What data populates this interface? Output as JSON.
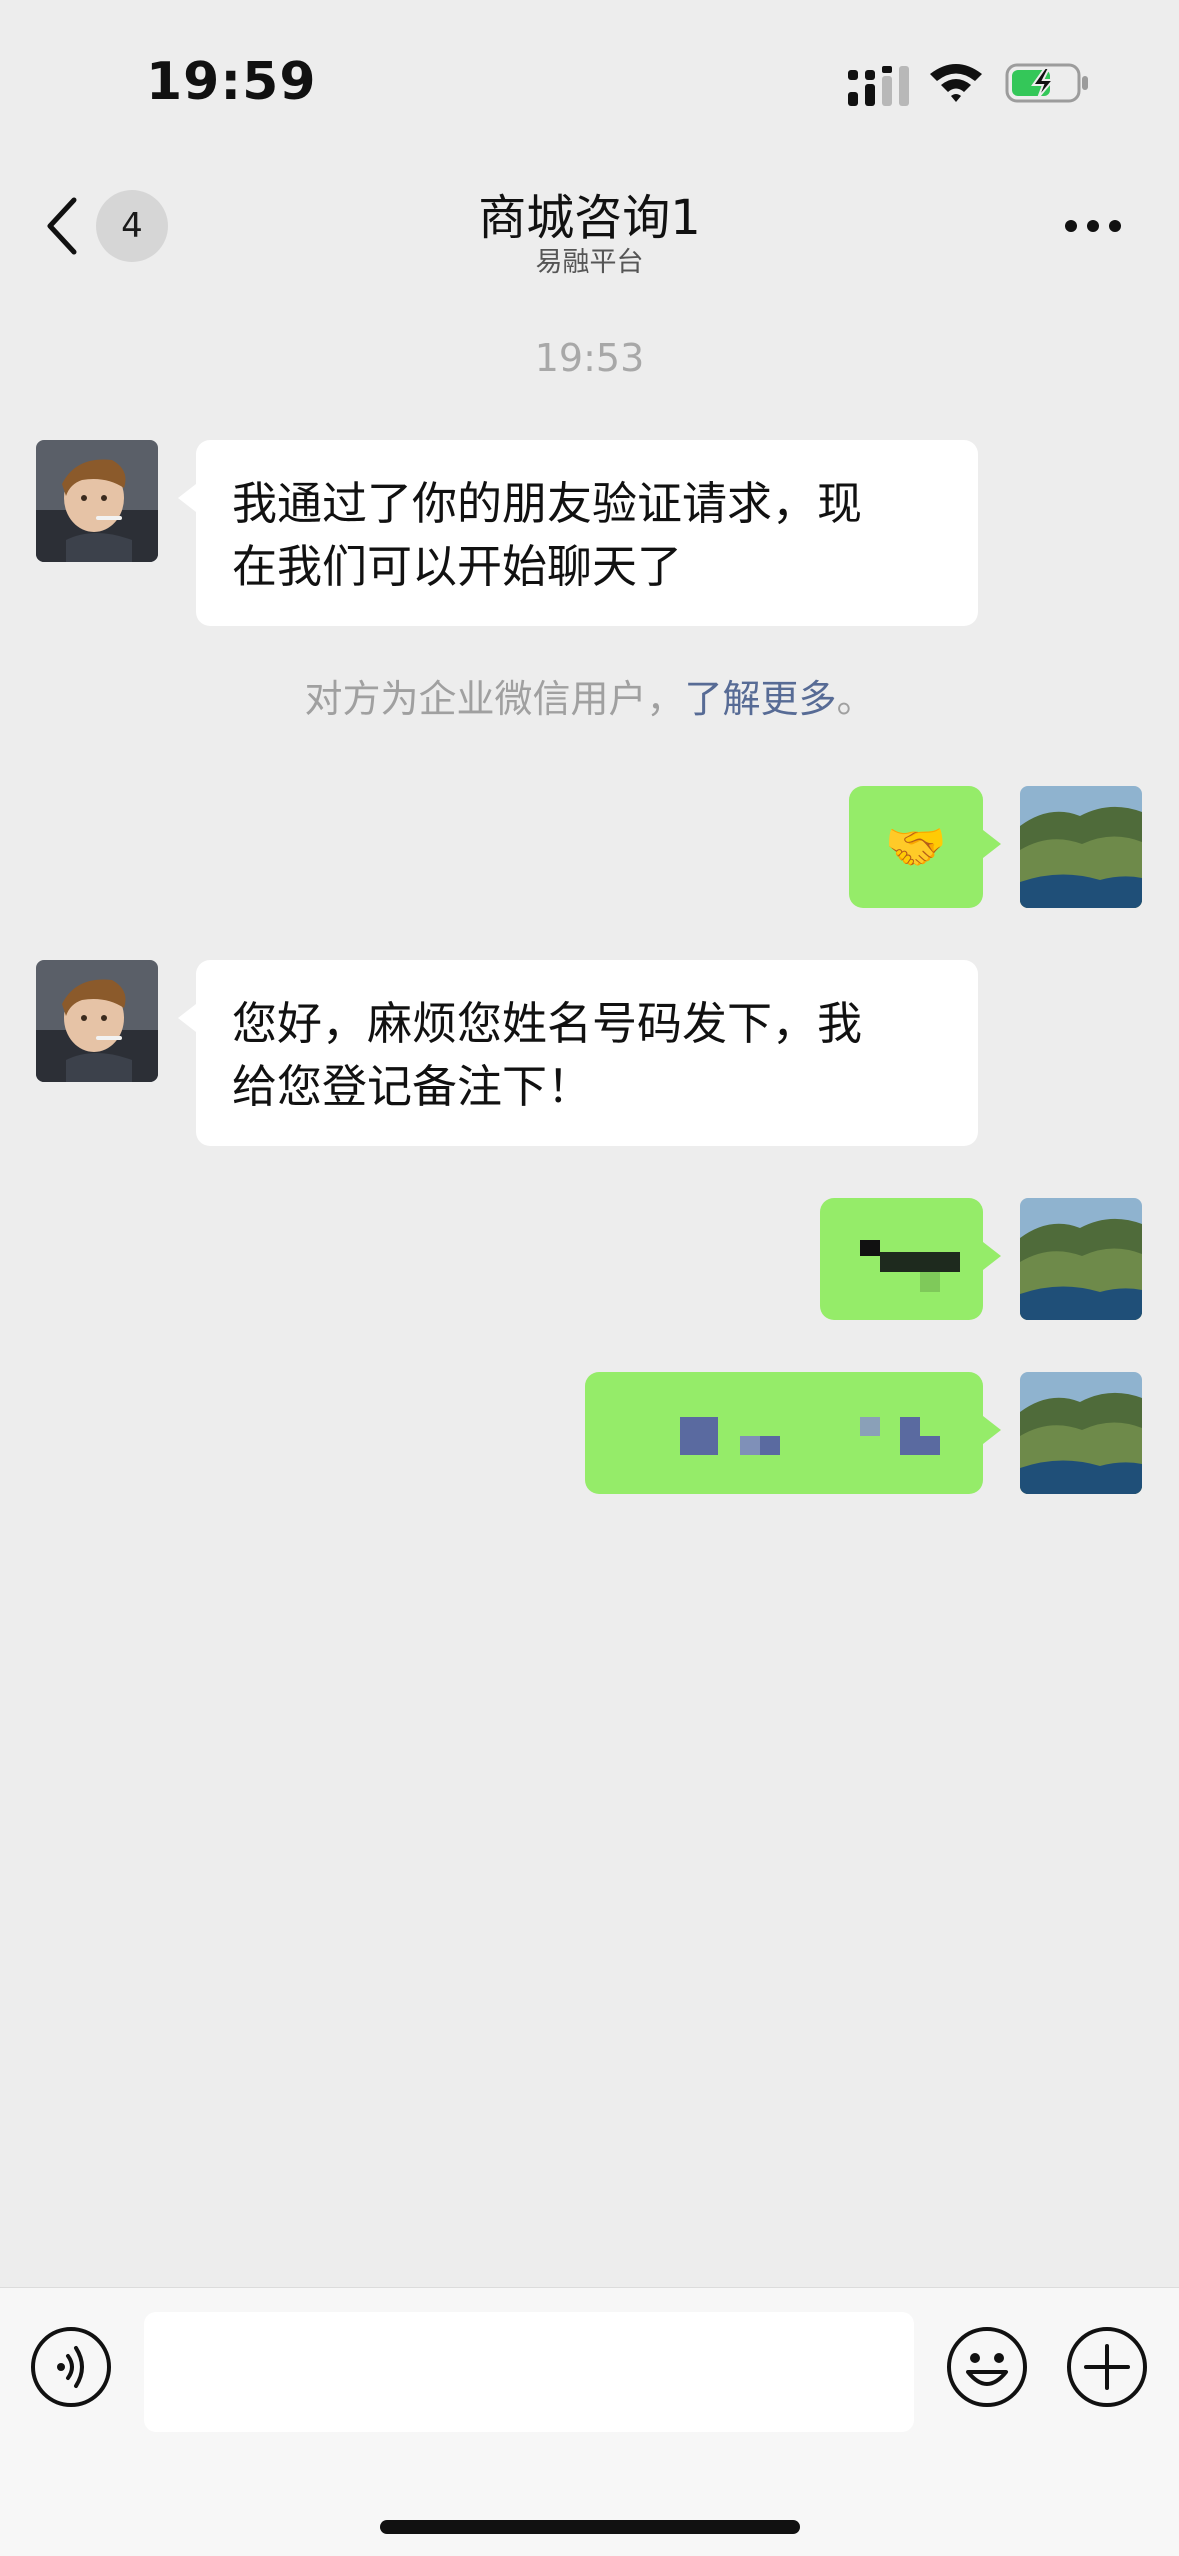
{
  "status_bar": {
    "time": "19:59"
  },
  "header": {
    "back_badge": "4",
    "title": "商城咨询1",
    "subtitle": "易融平台",
    "more_icon": "more-dots-icon"
  },
  "chat": {
    "timestamp": "19:53",
    "messages": [
      {
        "direction": "incoming",
        "lines": [
          "我通过了你的朋友验证请求，现",
          "在我们可以开始聊天了"
        ]
      },
      {
        "direction": "outgoing",
        "emoji": "🤝"
      },
      {
        "direction": "incoming",
        "lines": [
          "您好，麻烦您姓名号码发下，我",
          "给您登记备注下！"
        ]
      },
      {
        "direction": "outgoing",
        "content": "pixelated-redacted"
      },
      {
        "direction": "outgoing",
        "content": "pixelated-redacted"
      }
    ],
    "system_note": {
      "text": "对方为企业微信用户，",
      "link": "了解更多",
      "suffix": "。"
    }
  },
  "input_bar": {
    "voice_icon": "voice-wave-icon",
    "emoji_icon": "smiley-icon",
    "plus_icon": "plus-circle-icon"
  },
  "colors": {
    "background": "#ededed",
    "outgoing_bubble": "#95ec69",
    "incoming_bubble": "#ffffff",
    "link": "#576b95"
  }
}
